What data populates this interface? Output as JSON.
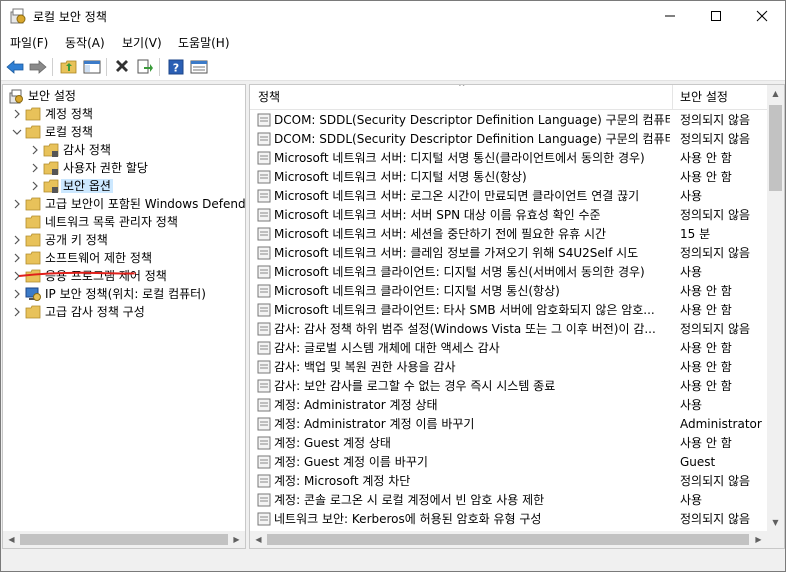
{
  "window": {
    "title": "로컬 보안 정책"
  },
  "menu": [
    {
      "label": "파일(F)"
    },
    {
      "label": "동작(A)"
    },
    {
      "label": "보기(V)"
    },
    {
      "label": "도움말(H)"
    }
  ],
  "toolbar": {
    "icons": [
      "back-arrow-icon",
      "forward-arrow-icon",
      "up-folder-icon",
      "show-hide-tree-icon",
      "delete-icon",
      "export-list-icon",
      "help-icon",
      "properties-icon"
    ]
  },
  "tree": {
    "root": "보안 설정",
    "items": [
      {
        "label": "계정 정책"
      },
      {
        "label": "로컬 정책"
      },
      {
        "label": "감사 정책"
      },
      {
        "label": "사용자 권한 할당"
      },
      {
        "label": "보안 옵션"
      },
      {
        "label": "고급 보안이 포함된 Windows Defender"
      },
      {
        "label": "네트워크 목록 관리자 정책"
      },
      {
        "label": "공개 키 정책"
      },
      {
        "label": "소프트웨어 제한 정책"
      },
      {
        "label": "응용 프로그램 제어 정책"
      },
      {
        "label": "IP 보안 정책(위치: 로컬 컴퓨터)"
      },
      {
        "label": "고급 감사 정책 구성"
      }
    ]
  },
  "list": {
    "columns": {
      "policy": "정책",
      "setting": "보안 설정"
    },
    "rows": [
      {
        "policy": "DCOM: SDDL(Security Descriptor Definition Language) 구문의 컴퓨터 ...",
        "setting": "정의되지 않음"
      },
      {
        "policy": "DCOM: SDDL(Security Descriptor Definition Language) 구문의 컴퓨터 ...",
        "setting": "정의되지 않음"
      },
      {
        "policy": "Microsoft 네트워크 서버: 디지털 서명 통신(클라이언트에서 동의한 경우)",
        "setting": "사용 안 함"
      },
      {
        "policy": "Microsoft 네트워크 서버: 디지털 서명 통신(항상)",
        "setting": "사용 안 함"
      },
      {
        "policy": "Microsoft 네트워크 서버: 로그온 시간이 만료되면 클라이언트 연결 끊기",
        "setting": "사용"
      },
      {
        "policy": "Microsoft 네트워크 서버: 서버 SPN 대상 이름 유효성 확인 수준",
        "setting": "정의되지 않음"
      },
      {
        "policy": "Microsoft 네트워크 서버: 세션을 중단하기 전에 필요한 유휴 시간",
        "setting": "15 분"
      },
      {
        "policy": "Microsoft 네트워크 서버: 클레임 정보를 가져오기 위해 S4U2Self 시도",
        "setting": "정의되지 않음"
      },
      {
        "policy": "Microsoft 네트워크 클라이언트: 디지털 서명 통신(서버에서 동의한 경우)",
        "setting": "사용"
      },
      {
        "policy": "Microsoft 네트워크 클라이언트: 디지털 서명 통신(항상)",
        "setting": "사용 안 함"
      },
      {
        "policy": "Microsoft 네트워크 클라이언트: 타사 SMB 서버에 암호화되지 않은 암호...",
        "setting": "사용 안 함"
      },
      {
        "policy": "감사: 감사 정책 하위 범주 설정(Windows Vista 또는 그 이후 버전)이 감...",
        "setting": "정의되지 않음"
      },
      {
        "policy": "감사: 글로벌 시스템 개체에 대한 액세스 감사",
        "setting": "사용 안 함"
      },
      {
        "policy": "감사: 백업 및 복원 권한 사용을 감사",
        "setting": "사용 안 함"
      },
      {
        "policy": "감사: 보안 감사를 로그할 수 없는 경우 즉시 시스템 종료",
        "setting": "사용 안 함"
      },
      {
        "policy": "계정: Administrator 계정 상태",
        "setting": "사용"
      },
      {
        "policy": "계정: Administrator 계정 이름 바꾸기",
        "setting": "Administrator"
      },
      {
        "policy": "계정: Guest 계정 상태",
        "setting": "사용 안 함"
      },
      {
        "policy": "계정: Guest 계정 이름 바꾸기",
        "setting": "Guest"
      },
      {
        "policy": "계정: Microsoft 계정 차단",
        "setting": "정의되지 않음"
      },
      {
        "policy": "계정: 콘솔 로그온 시 로컬 계정에서 빈 암호 사용 제한",
        "setting": "사용"
      },
      {
        "policy": "네트워크 보안: Kerberos에 허용된 암호화 유형 구성",
        "setting": "정의되지 않음"
      }
    ]
  },
  "colors": {
    "selection": "#cce8ff",
    "annotation": "#e0201a",
    "folder": "#e8c25a"
  }
}
